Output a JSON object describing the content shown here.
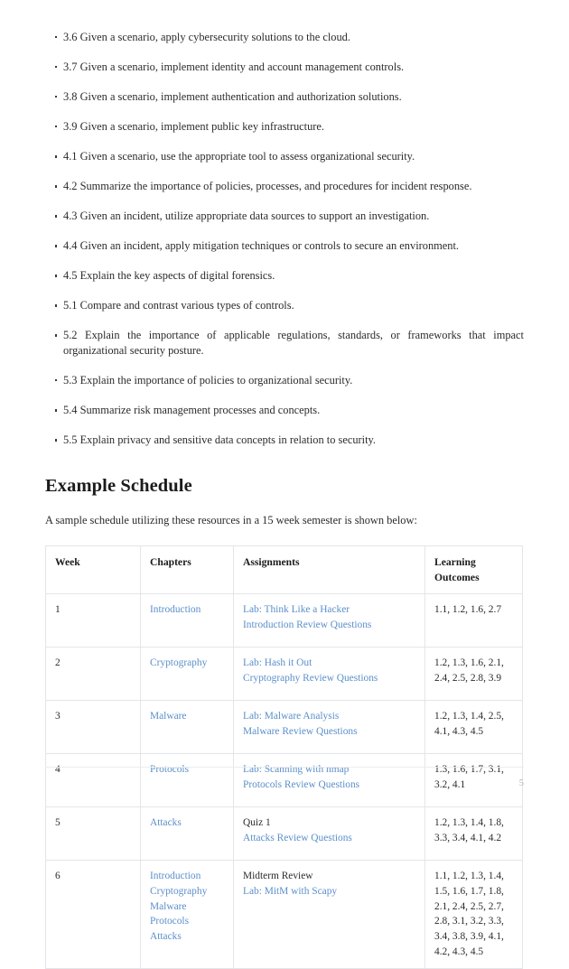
{
  "objectives": [
    "3.6 Given a scenario, apply cybersecurity solutions to the cloud.",
    "3.7 Given a scenario, implement identity and account management controls.",
    "3.8 Given a scenario, implement authentication and authorization solutions.",
    "3.9 Given a scenario, implement public key infrastructure.",
    "4.1 Given a scenario, use the appropriate tool to assess organizational security.",
    "4.2 Summarize the importance of policies, processes, and procedures for incident response.",
    "4.3 Given an incident, utilize appropriate data sources to support an investigation.",
    "4.4 Given an incident, apply mitigation techniques or controls to secure an environment.",
    "4.5 Explain the key aspects of digital forensics.",
    "5.1 Compare and contrast various types of controls.",
    "5.2 Explain the importance of applicable regulations, standards, or frameworks that impact organizational security posture.",
    "5.3 Explain the importance of policies to organizational security.",
    "5.4 Summarize risk management processes and concepts.",
    "5.5 Explain privacy and sensitive data concepts in relation to security."
  ],
  "section": {
    "heading": "Example Schedule",
    "intro": "A sample schedule utilizing these resources in a 15 week semester is shown below:"
  },
  "table": {
    "headers": {
      "week": "Week",
      "chapters": "Chapters",
      "assignments": "Assignments",
      "outcomes_line1": "Learning",
      "outcomes_line2": "Outcomes"
    },
    "rows": [
      {
        "week": "1",
        "chapters": [
          {
            "text": "Introduction",
            "link": true
          }
        ],
        "assignments": [
          {
            "text": "Lab: Think Like a Hacker",
            "link": true
          },
          {
            "text": "Introduction Review Questions",
            "link": true
          }
        ],
        "outcomes": "1.1, 1.2, 1.6, 2.7"
      },
      {
        "week": "2",
        "chapters": [
          {
            "text": "Cryptography",
            "link": true
          }
        ],
        "assignments": [
          {
            "text": "Lab: Hash it Out",
            "link": true
          },
          {
            "text": "Cryptography Review Questions",
            "link": true
          }
        ],
        "outcomes": "1.2, 1.3, 1.6, 2.1, 2.4, 2.5, 2.8, 3.9"
      },
      {
        "week": "3",
        "chapters": [
          {
            "text": "Malware",
            "link": true
          }
        ],
        "assignments": [
          {
            "text": "Lab: Malware Analysis",
            "link": true
          },
          {
            "text": "Malware Review Questions",
            "link": true
          }
        ],
        "outcomes": "1.2, 1.3, 1.4, 2.5, 4.1, 4.3, 4.5"
      },
      {
        "week": "4",
        "chapters": [
          {
            "text": "Protocols",
            "link": true
          }
        ],
        "assignments": [
          {
            "text": "Lab: Scanning with nmap",
            "link": true
          },
          {
            "text": "Protocols Review Questions",
            "link": true
          }
        ],
        "outcomes": "1.3, 1.6, 1.7, 3.1, 3.2, 4.1"
      },
      {
        "week": "5",
        "chapters": [
          {
            "text": "Attacks",
            "link": true
          }
        ],
        "assignments": [
          {
            "text": "Quiz 1",
            "link": false
          },
          {
            "text": "Attacks Review Questions",
            "link": true
          }
        ],
        "outcomes": "1.2, 1.3, 1.4, 1.8, 3.3, 3.4, 4.1, 4.2"
      },
      {
        "week": "6",
        "chapters": [
          {
            "text": "Introduction",
            "link": true
          },
          {
            "text": "Cryptography",
            "link": true
          },
          {
            "text": "Malware",
            "link": true
          },
          {
            "text": "Protocols",
            "link": true
          },
          {
            "text": "Attacks",
            "link": true
          }
        ],
        "assignments": [
          {
            "text": "Midterm Review",
            "link": false
          },
          {
            "text": "Lab: MitM with Scapy",
            "link": true
          }
        ],
        "outcomes": "1.1, 1.2, 1.3, 1.4, 1.5, 1.6, 1.7, 1.8, 2.1, 2.4, 2.5, 2.7, 2.8, 3.1, 3.2, 3.3, 3.4, 3.8, 3.9, 4.1, 4.2, 4.3, 4.5"
      }
    ]
  },
  "footer": {
    "page_number": "5"
  },
  "colors": {
    "link": "#5b8fca",
    "text": "#2b2b2b",
    "border": "#e3e5e8",
    "page_number": "#b4b4b4"
  }
}
